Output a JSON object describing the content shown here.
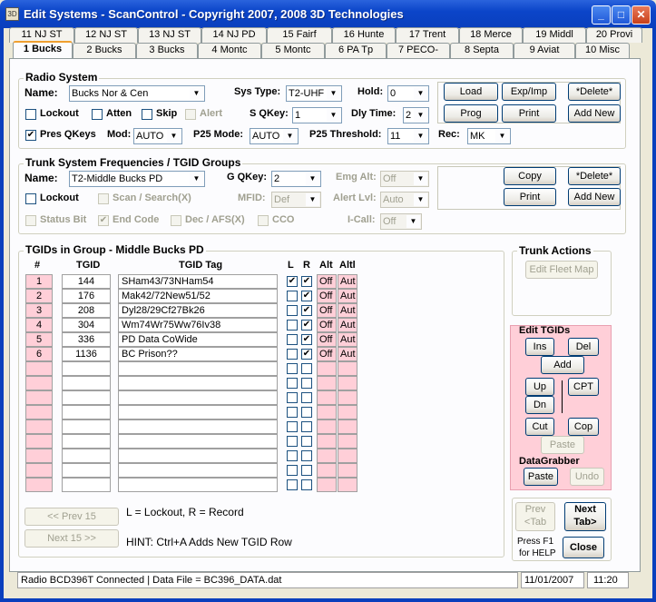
{
  "window": {
    "title": "Edit Systems - ScanControl - Copyright 2007, 2008 3D Technologies",
    "icon_label": "3D"
  },
  "tabs_top": [
    "11 NJ ST",
    "12 NJ ST",
    "13 NJ ST",
    "14 NJ PD",
    "15 Fairf",
    "16 Hunte",
    "17 Trent",
    "18 Merce",
    "19 Middl",
    "20 Provi"
  ],
  "tabs_bottom": [
    "1 Bucks",
    "2 Bucks",
    "3 Bucks",
    "4 Montc",
    "5 Montc",
    "6 PA Tp",
    "7 PECO-",
    "8 Septa",
    "9 Aviat",
    "10 Misc"
  ],
  "radio": {
    "title": "Radio System",
    "name_label": "Name:",
    "name_value": "Bucks Nor & Cen",
    "systype_label": "Sys Type:",
    "systype_value": "T2-UHF",
    "hold_label": "Hold:",
    "hold_value": "0",
    "lockout": "Lockout",
    "atten": "Atten",
    "skip": "Skip",
    "alert": "Alert",
    "sqkey_label": "S QKey:",
    "sqkey_value": "1",
    "dly_label": "Dly Time:",
    "dly_value": "2",
    "pres": "Pres QKeys",
    "mod_label": "Mod:",
    "mod_value": "AUTO",
    "p25mode_label": "P25 Mode:",
    "p25mode_value": "AUTO",
    "p25t_label": "P25 Threshold:",
    "p25t_value": "11",
    "rec_label": "Rec:",
    "rec_value": "MK",
    "load": "Load",
    "expimp": "Exp/Imp",
    "delete": "*Delete*",
    "prog": "Prog",
    "print": "Print",
    "addnew": "Add New"
  },
  "trunk": {
    "title": "Trunk System Frequencies / TGID Groups",
    "name_label": "Name:",
    "name_value": "T2-Middle Bucks PD",
    "gqkey_label": "G QKey:",
    "gqkey_value": "2",
    "emg_label": "Emg Alt:",
    "emg_value": "Off",
    "lockout": "Lockout",
    "scan": "Scan / Search(X)",
    "mfid_label": "MFID:",
    "mfid_value": "Def",
    "alertlvl_label": "Alert Lvl:",
    "alertlvl_value": "Auto",
    "statusbit": "Status Bit",
    "endcode": "End Code",
    "dec": "Dec / AFS(X)",
    "cco": "CCO",
    "icall_label": "I-Call:",
    "icall_value": "Off",
    "copy": "Copy",
    "delete": "*Delete*",
    "print": "Print",
    "addnew": "Add New"
  },
  "tgids": {
    "title": "TGIDs in Group - Middle Bucks PD",
    "headers": [
      "#",
      "TGID",
      "TGID Tag",
      "L",
      "R",
      "Alt",
      "Altl"
    ],
    "rows": [
      {
        "n": "1",
        "tgid": "144",
        "tag": "SHam43/73NHam54",
        "l": true,
        "r": true,
        "alt": "Off",
        "altl": "Aut"
      },
      {
        "n": "2",
        "tgid": "176",
        "tag": "Mak42/72New51/52",
        "l": false,
        "r": true,
        "alt": "Off",
        "altl": "Aut"
      },
      {
        "n": "3",
        "tgid": "208",
        "tag": "Dyl28/29Cf27Bk26",
        "l": false,
        "r": true,
        "alt": "Off",
        "altl": "Aut"
      },
      {
        "n": "4",
        "tgid": "304",
        "tag": "Wm74Wr75Ww76Iv38",
        "l": false,
        "r": true,
        "alt": "Off",
        "altl": "Aut"
      },
      {
        "n": "5",
        "tgid": "336",
        "tag": "PD Data CoWide",
        "l": false,
        "r": true,
        "alt": "Off",
        "altl": "Aut"
      },
      {
        "n": "6",
        "tgid": "1136",
        "tag": "BC Prison??",
        "l": false,
        "r": true,
        "alt": "Off",
        "altl": "Aut"
      }
    ],
    "empty_rows": 9,
    "prev": "<< Prev 15",
    "next": "Next 15 >>",
    "legend": "L = Lockout, R = Record",
    "hint": "HINT:  Ctrl+A Adds New TGID Row"
  },
  "actions": {
    "title": "Trunk Actions",
    "editfleet": "Edit Fleet Map"
  },
  "edit": {
    "title": "Edit TGIDs",
    "ins": "Ins",
    "del": "Del",
    "add": "Add",
    "up": "Up",
    "dn": "Dn",
    "cpt": "CPT",
    "cut": "Cut",
    "cop": "Cop",
    "paste": "Paste"
  },
  "grabber": {
    "title": "DataGrabber",
    "paste": "Paste",
    "undo": "Undo"
  },
  "nav": {
    "prev1": "Prev",
    "prev2": "<Tab",
    "next1": "Next",
    "next2": "Tab>",
    "help1": "Press F1",
    "help2": "for HELP",
    "close": "Close"
  },
  "status": {
    "text": "Radio BCD396T Connected | Data File = BC396_DATA.dat",
    "date": "11/01/2007",
    "time": "11:20"
  }
}
